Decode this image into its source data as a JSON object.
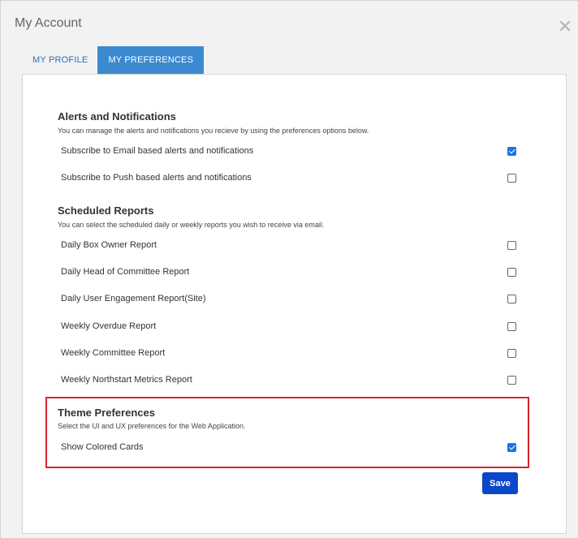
{
  "modal": {
    "title": "My Account"
  },
  "tabs": [
    {
      "label": "MY PROFILE",
      "active": false
    },
    {
      "label": "MY PREFERENCES",
      "active": true
    }
  ],
  "sections": {
    "alerts": {
      "title": "Alerts and Notifications",
      "description": "You can manage the alerts and notifications you recieve by using the preferences options below.",
      "items": [
        {
          "label": "Subscribe to Email based alerts and notifications",
          "checked": true
        },
        {
          "label": "Subscribe to Push based alerts and notifications",
          "checked": false
        }
      ]
    },
    "reports": {
      "title": "Scheduled Reports",
      "description": "You can select the scheduled daily or weekly reports you wish to receive via email.",
      "items": [
        {
          "label": "Daily Box Owner Report",
          "checked": false
        },
        {
          "label": "Daily Head of Committee Report",
          "checked": false
        },
        {
          "label": "Daily User Engagement Report(Site)",
          "checked": false
        },
        {
          "label": "Weekly Overdue Report",
          "checked": false
        },
        {
          "label": "Weekly Committee Report",
          "checked": false
        },
        {
          "label": "Weekly Northstart Metrics Report",
          "checked": false
        }
      ]
    },
    "theme": {
      "title": "Theme Preferences",
      "description": "Select the UI and UX preferences for the Web Application.",
      "items": [
        {
          "label": "Show Colored Cards",
          "checked": true
        }
      ]
    }
  },
  "actions": {
    "save_label": "Save"
  },
  "colors": {
    "accent_tab": "#3b8ad0",
    "save_button": "#0d47c9",
    "checkbox_checked": "#1a73e8",
    "highlight_border": "#d9242f"
  },
  "icons": {
    "close": "close-icon"
  }
}
